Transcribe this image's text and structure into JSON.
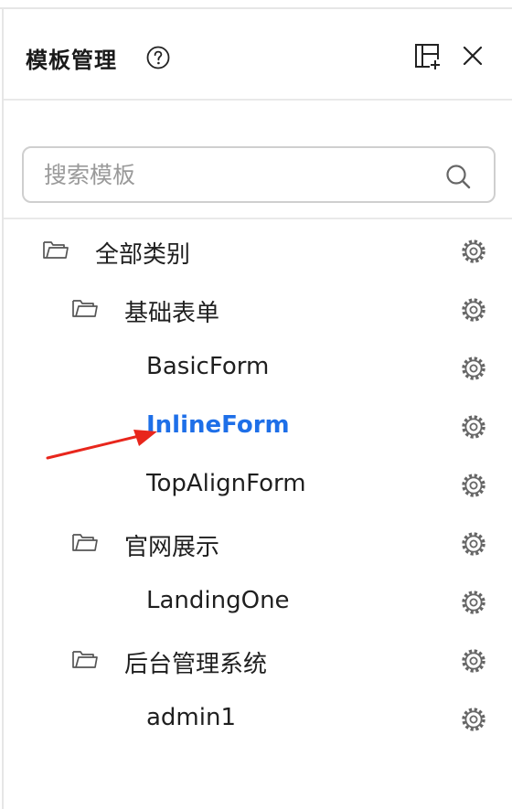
{
  "header": {
    "title": "模板管理",
    "help_icon": "help-circle-icon",
    "layout_icon": "layout-add-icon",
    "close_icon": "close-icon"
  },
  "search": {
    "placeholder": "搜索模板",
    "value": "",
    "icon": "search-icon"
  },
  "tree": {
    "items": [
      {
        "label": "全部类别",
        "type": "folder",
        "level": 0
      },
      {
        "label": "基础表单",
        "type": "folder",
        "level": 1
      },
      {
        "label": "BasicForm",
        "type": "template",
        "level": 2
      },
      {
        "label": "InlineForm",
        "type": "template",
        "level": 2,
        "selected": true
      },
      {
        "label": "TopAlignForm",
        "type": "template",
        "level": 2
      },
      {
        "label": "官网展示",
        "type": "folder",
        "level": 1
      },
      {
        "label": "LandingOne",
        "type": "template",
        "level": 2
      },
      {
        "label": "后台管理系统",
        "type": "folder",
        "level": 1
      },
      {
        "label": "admin1",
        "type": "template",
        "level": 2
      }
    ]
  },
  "colors": {
    "accent": "#1e6fe8",
    "annotation_arrow": "#e8261c"
  }
}
